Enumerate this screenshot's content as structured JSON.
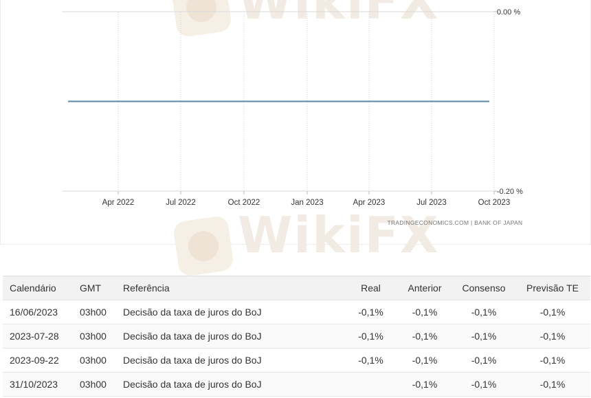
{
  "watermark": {
    "text": "WikiFX"
  },
  "chart_data": {
    "type": "line",
    "x_ticks": [
      "Apr 2022",
      "Jul 2022",
      "Oct 2022",
      "Jan 2023",
      "Apr 2023",
      "Jul 2023",
      "Oct 2023"
    ],
    "y_ticks": [
      "0.00 %",
      "-0.20 %"
    ],
    "ylim": [
      -0.2,
      0.0
    ],
    "series": [
      {
        "x_start": "2022-01",
        "x_end": "2023-10",
        "values": [
          -0.1,
          -0.1
        ],
        "color": "#5a88a8"
      }
    ],
    "grid": true,
    "source": "TRADINGECONOMICS.COM  |  BANK OF JAPAN"
  },
  "table": {
    "headers": [
      "Calendário",
      "GMT",
      "Referência",
      "Real",
      "Anterior",
      "Consenso",
      "Previsão TE"
    ],
    "rows": [
      [
        "16/06/2023",
        "03h00",
        "Decisão da taxa de juros do BoJ",
        "-0,1%",
        "-0,1%",
        "-0,1%",
        "-0,1%"
      ],
      [
        "2023-07-28",
        "03h00",
        "Decisão da taxa de juros do BoJ",
        "-0,1%",
        "-0,1%",
        "-0,1%",
        "-0,1%"
      ],
      [
        "2023-09-22",
        "03h00",
        "Decisão da taxa de juros do BoJ",
        "-0,1%",
        "-0,1%",
        "-0,1%",
        "-0,1%"
      ],
      [
        "31/10/2023",
        "03h00",
        "Decisão da taxa de juros do BoJ",
        "",
        "-0,1%",
        "-0,1%",
        "-0,1%"
      ]
    ]
  }
}
